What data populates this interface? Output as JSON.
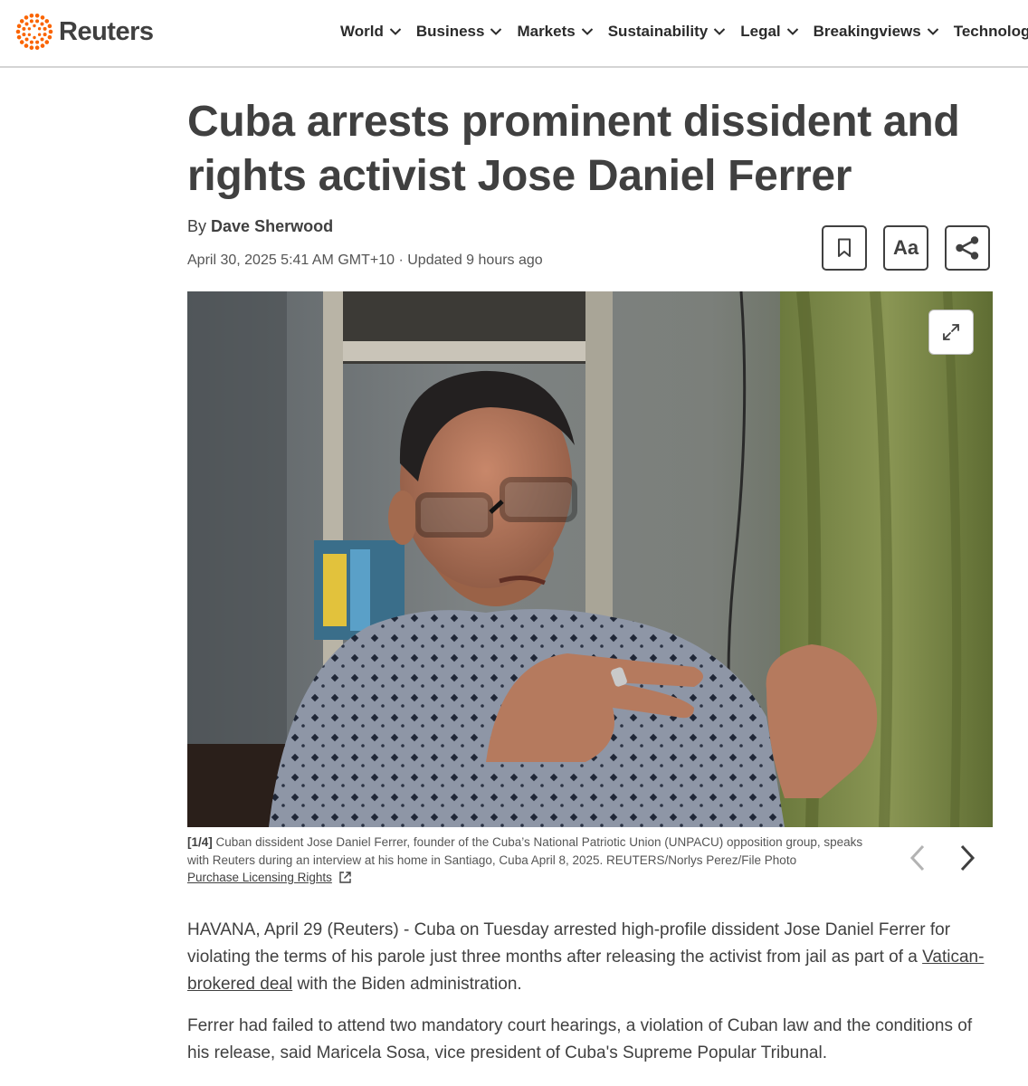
{
  "brand": {
    "name": "Reuters",
    "accent": "#fa6400",
    "text_color": "#404040"
  },
  "nav": {
    "items": [
      {
        "label": "World"
      },
      {
        "label": "Business"
      },
      {
        "label": "Markets"
      },
      {
        "label": "Sustainability"
      },
      {
        "label": "Legal"
      },
      {
        "label": "Breakingviews"
      },
      {
        "label": "Technology"
      }
    ],
    "dropdown_icon": "chevron-down-icon"
  },
  "article": {
    "headline": "Cuba arrests prominent dissident and rights activist Jose Daniel Ferrer",
    "byline_prefix": "By",
    "author": "Dave Sherwood",
    "dateline": "April 30, 2025 5:41 AM GMT+10 · Updated 9 hours ago",
    "tools": {
      "bookmark_icon": "bookmark-icon",
      "font_size_label": "Aa",
      "share_icon": "share-icon"
    }
  },
  "media": {
    "expand_icon": "expand-icon",
    "index": "[1/4]",
    "caption": "Cuban dissident Jose Daniel Ferrer, founder of the Cuba’s National Patriotic Union (UNPACU) opposition group, speaks with Reuters during an interview at his home in Santiago, Cuba April 8, 2025. REUTERS/Norlys Perez/File Photo",
    "licensing": "Purchase Licensing Rights",
    "prev_icon": "chevron-left-icon",
    "next_icon": "chevron-right-icon"
  },
  "body": {
    "p1_before_link": "HAVANA, April 29 (Reuters) - Cuba on Tuesday arrested high-profile dissident Jose Daniel Ferrer for violating the terms of his parole just three months after releasing the activist from jail as part of a ",
    "p1_link": "Vatican-brokered deal",
    "p1_after_link": " with the Biden administration.",
    "p2": "Ferrer had failed to attend two mandatory court hearings, a violation of Cuban law and the conditions of his release, said Maricela Sosa, vice president of Cuba's Supreme Popular Tribunal."
  }
}
